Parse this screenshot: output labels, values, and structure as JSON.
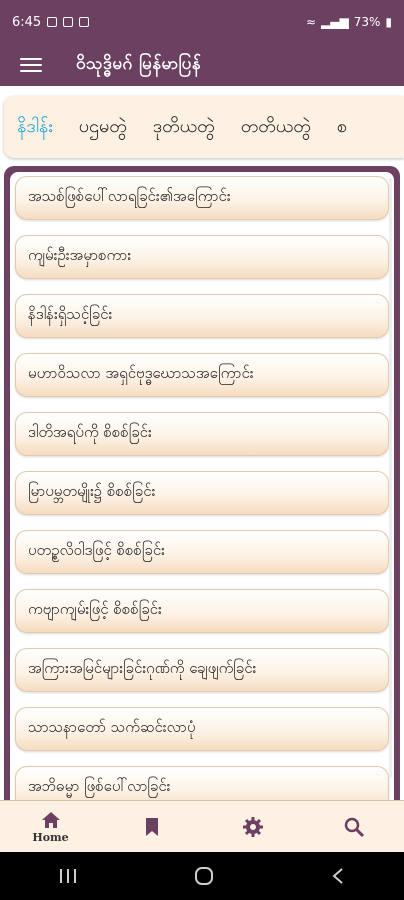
{
  "status_bar": {
    "time": "6:45",
    "battery": "73%"
  },
  "app_bar": {
    "title": "ဝိသုဒ္ဓိမဂ် မြန်မာပြန်"
  },
  "tabs": [
    {
      "label": "နိဒါန်း"
    },
    {
      "label": "ပဌမတွဲ"
    },
    {
      "label": "ဒုတိယတွဲ"
    },
    {
      "label": "တတိယတွဲ"
    },
    {
      "label": "စ"
    }
  ],
  "items": [
    {
      "label": "အသစ်ဖြစ်ပေါ်လာရခြင်း၏အကြောင်း"
    },
    {
      "label": "ကျမ်းဦးအမှာစကား"
    },
    {
      "label": "နိဒါန်းရှိသင့်ခြင်း"
    },
    {
      "label": "မဟာဝိသလာ အရှင်ဗုဒ္ဓဃောသအကြောင်း"
    },
    {
      "label": "ဒါတိအရပ်ကို စိစစ်ခြင်း"
    },
    {
      "label": "မြာပမ္ဘတမျိုး၌ စိစစ်ခြင်း"
    },
    {
      "label": "ပတဥ္စလိဝါဒဖြင့် စိစစ်ခြင်း"
    },
    {
      "label": "ကဗျာကျမ်းဖြင့် စိစစ်ခြင်း"
    },
    {
      "label": "အကြားအမြင်များခြင်းဂုဏ်ကို ချေဖျက်ခြင်း"
    },
    {
      "label": "သာသနာတော် သက်ဆင်းလာပုံ"
    },
    {
      "label": "အဘိဓမ္မာ ဖြစ်ပေါ်လာခြင်း"
    }
  ],
  "bottom_nav": [
    {
      "icon": "home-icon",
      "label": "Home"
    },
    {
      "icon": "bookmark-icon",
      "label": ""
    },
    {
      "icon": "gear-icon",
      "label": ""
    },
    {
      "icon": "search-icon",
      "label": ""
    }
  ],
  "colors": {
    "primary": "#6b4061",
    "accent": "#1aa0d8",
    "tab_bg": "#fdf1e4"
  }
}
